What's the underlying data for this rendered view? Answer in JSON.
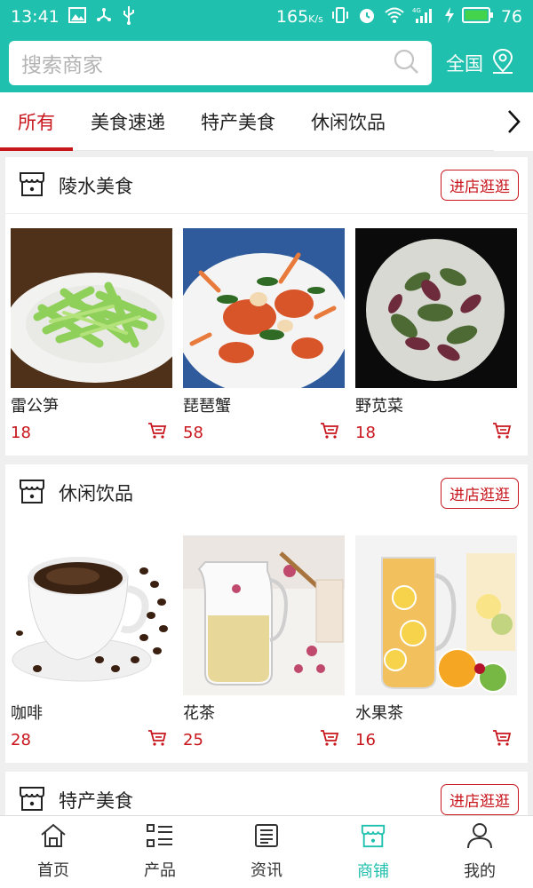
{
  "status_bar": {
    "time": "13:41",
    "speed": "165",
    "speed_unit": "K/s",
    "battery": "76"
  },
  "search": {
    "placeholder": "搜索商家",
    "region": "全国"
  },
  "tabs": [
    {
      "label": "所有",
      "active": true
    },
    {
      "label": "美食速递"
    },
    {
      "label": "特产美食"
    },
    {
      "label": "休闲饮品"
    }
  ],
  "stores": [
    {
      "name": "陵水美食",
      "visit_label": "进店逛逛",
      "products": [
        {
          "name": "雷公笋",
          "price": "18"
        },
        {
          "name": "琵琶蟹",
          "price": "58"
        },
        {
          "name": "野苋菜",
          "price": "18"
        }
      ]
    },
    {
      "name": "休闲饮品",
      "visit_label": "进店逛逛",
      "products": [
        {
          "name": "咖啡",
          "price": "28"
        },
        {
          "name": "花茶",
          "price": "25"
        },
        {
          "name": "水果茶",
          "price": "16"
        }
      ]
    },
    {
      "name": "特产美食",
      "visit_label": "进店逛逛",
      "products": []
    }
  ],
  "bottom_nav": [
    {
      "label": "首页",
      "icon": "home-icon"
    },
    {
      "label": "产品",
      "icon": "list-icon"
    },
    {
      "label": "资讯",
      "icon": "news-icon"
    },
    {
      "label": "商铺",
      "icon": "store-icon",
      "active": true
    },
    {
      "label": "我的",
      "icon": "user-icon"
    }
  ],
  "colors": {
    "primary": "#1fc0ad",
    "accent": "#c8161d"
  }
}
